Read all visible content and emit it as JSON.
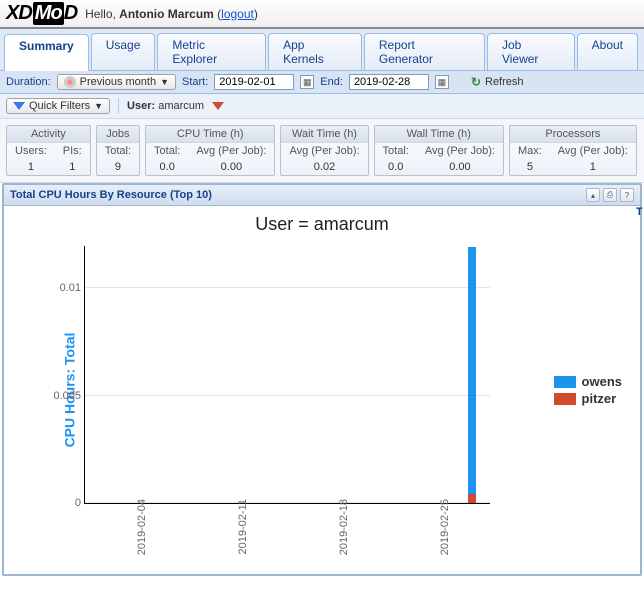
{
  "header": {
    "logo_xd": "XD",
    "logo_mo": "Mo",
    "logo_d": "D",
    "greeting_prefix": "Hello, ",
    "user_name": "Antonio Marcum",
    "logout_label": "logout"
  },
  "tabs": [
    {
      "label": "Summary",
      "active": true
    },
    {
      "label": "Usage",
      "active": false
    },
    {
      "label": "Metric Explorer",
      "active": false
    },
    {
      "label": "App Kernels",
      "active": false
    },
    {
      "label": "Report Generator",
      "active": false
    },
    {
      "label": "Job Viewer",
      "active": false
    },
    {
      "label": "About",
      "active": false
    }
  ],
  "duration_toolbar": {
    "duration_label": "Duration:",
    "preset": "Previous month",
    "start_label": "Start:",
    "start_value": "2019-02-01",
    "end_label": "End:",
    "end_value": "2019-02-28",
    "refresh_label": "Refresh"
  },
  "quickfilter": {
    "quick_label": "Quick Filters",
    "user_label": "User:",
    "user_value": "amarcum"
  },
  "cards": {
    "activity": {
      "title": "Activity",
      "cols": [
        "Users:",
        "PIs:"
      ],
      "vals": [
        "1",
        "1"
      ]
    },
    "jobs": {
      "title": "Jobs",
      "cols": [
        "Total:"
      ],
      "vals": [
        "9"
      ]
    },
    "cpu": {
      "title": "CPU Time (h)",
      "cols": [
        "Total:",
        "Avg (Per Job):"
      ],
      "vals": [
        "0.0",
        "0.00"
      ]
    },
    "wait": {
      "title": "Wait Time (h)",
      "cols": [
        "Avg (Per Job):"
      ],
      "vals": [
        "0.02"
      ]
    },
    "wall": {
      "title": "Wall Time (h)",
      "cols": [
        "Total:",
        "Avg (Per Job):"
      ],
      "vals": [
        "0.0",
        "0.00"
      ]
    },
    "proc": {
      "title": "Processors",
      "cols": [
        "Max:",
        "Avg (Per Job):"
      ],
      "vals": [
        "5",
        "1"
      ]
    }
  },
  "panel": {
    "title": "Total CPU Hours By Resource (Top 10)",
    "next_hint": "T"
  },
  "chart_data": {
    "type": "bar",
    "title": "User = amarcum",
    "ylabel": "CPU Hours: Total",
    "xlabel": "",
    "ylim": [
      0,
      0.012
    ],
    "yticks": [
      0,
      0.005,
      0.01
    ],
    "categories": [
      "2019-02-04",
      "2019-02-11",
      "2019-02-18",
      "2019-02-25"
    ],
    "series": [
      {
        "name": "owens",
        "color": "#1d93f0",
        "values": [
          0,
          0,
          0,
          0.0115
        ]
      },
      {
        "name": "pitzer",
        "color": "#d04a2e",
        "values": [
          0,
          0,
          0,
          0.0004
        ]
      }
    ],
    "legend_position": "right"
  }
}
